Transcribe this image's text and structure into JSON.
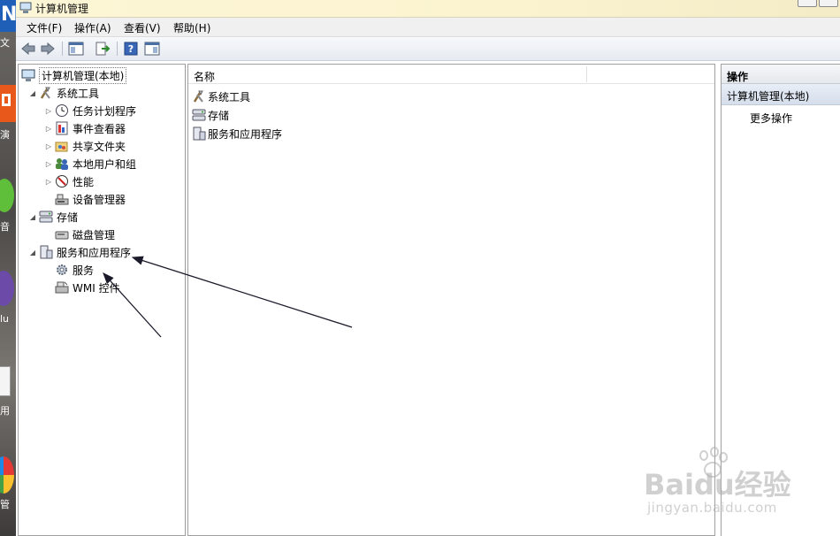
{
  "desktop": {
    "labels": [
      "文",
      "演",
      "音",
      "lu",
      "用",
      "管"
    ],
    "badge": "N"
  },
  "window": {
    "title": "计算机管理"
  },
  "menu": {
    "items": [
      "文件(F)",
      "操作(A)",
      "查看(V)",
      "帮助(H)"
    ]
  },
  "tree": {
    "root": "计算机管理(本地)",
    "items": [
      {
        "label": "系统工具",
        "icon": "tools-icon"
      },
      {
        "label": "任务计划程序",
        "icon": "clock-icon"
      },
      {
        "label": "事件查看器",
        "icon": "event-viewer-icon"
      },
      {
        "label": "共享文件夹",
        "icon": "shared-folder-icon"
      },
      {
        "label": "本地用户和组",
        "icon": "users-icon"
      },
      {
        "label": "性能",
        "icon": "performance-icon"
      },
      {
        "label": "设备管理器",
        "icon": "device-manager-icon"
      },
      {
        "label": "存储",
        "icon": "storage-icon"
      },
      {
        "label": "磁盘管理",
        "icon": "disk-icon"
      },
      {
        "label": "服务和应用程序",
        "icon": "services-apps-icon"
      },
      {
        "label": "服务",
        "icon": "gear-icon"
      },
      {
        "label": "WMI 控件",
        "icon": "wmi-icon"
      }
    ]
  },
  "list": {
    "column_name": "名称",
    "rows": [
      {
        "label": "系统工具",
        "icon": "tools-icon"
      },
      {
        "label": "存储",
        "icon": "storage-icon"
      },
      {
        "label": "服务和应用程序",
        "icon": "services-apps-icon"
      }
    ]
  },
  "actions": {
    "header": "操作",
    "section": "计算机管理(本地)",
    "more": "更多操作"
  },
  "watermark": {
    "brand": "Baidu经验",
    "url": "jingyan.baidu.com"
  },
  "colors": {
    "title_bg": "#fbf3d0",
    "action_section": "#dbe3ee",
    "annotation_arrow": "#1a1a2a"
  }
}
